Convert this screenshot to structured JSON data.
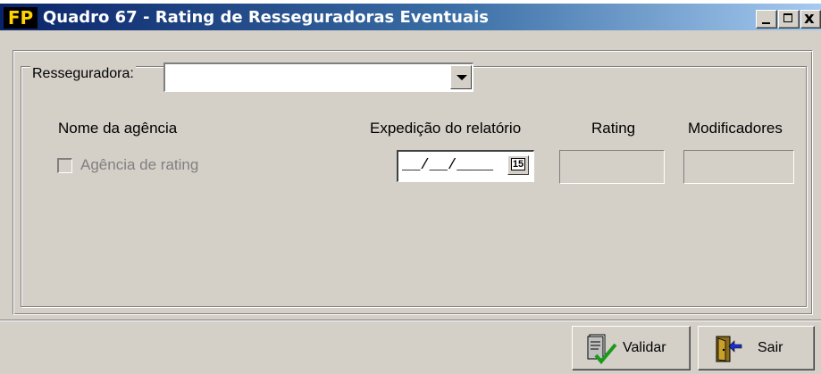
{
  "window": {
    "app_icon_text": "FP",
    "title": "Quadro 67 - Rating de Resseguradoras Eventuais",
    "minimize_icon": "minimize-icon",
    "maximize_icon": "maximize-icon",
    "close_glyph": "x"
  },
  "form": {
    "resseguradora_label": "Resseguradora:",
    "resseguradora_value": "",
    "col_nome": "Nome da agência",
    "col_expedicao": "Expedição do relatório",
    "col_rating": "Rating",
    "col_modificadores": "Modificadores",
    "checkbox_label": "Agência de rating",
    "checkbox_checked": false,
    "date_mask": "__/__/____",
    "calendar_day": "15",
    "rating_value": "",
    "modificadores_value": ""
  },
  "buttons": {
    "validar": "Validar",
    "sair": "Sair"
  },
  "colors": {
    "face": "#d4d0c8",
    "title_start": "#0a246a",
    "title_end": "#a6caf0",
    "disabled_text": "#808080"
  }
}
